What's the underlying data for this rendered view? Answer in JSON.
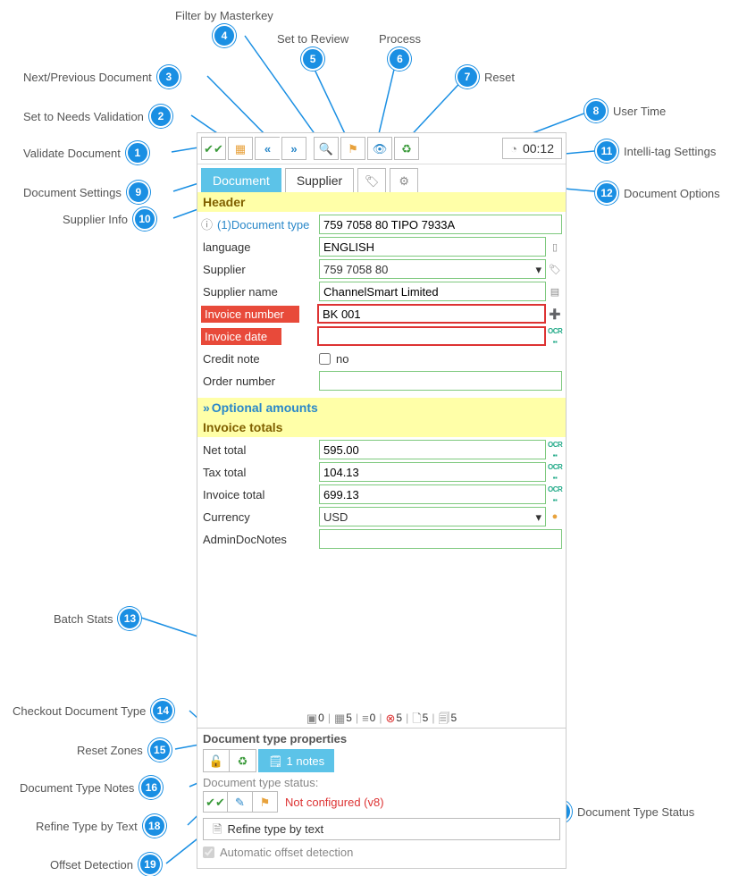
{
  "callouts": {
    "c1": "Validate Document",
    "c2": "Set to Needs Validation",
    "c3": "Next/Previous Document",
    "c4": "Filter by Masterkey",
    "c5": "Set to Review",
    "c6": "Process",
    "c7": "Reset",
    "c8": "User Time",
    "c9": "Document Settings",
    "c10": "Supplier Info",
    "c11": "Intelli-tag Settings",
    "c12": "Document Options",
    "c13": "Batch Stats",
    "c14": "Checkout Document Type",
    "c15": "Reset Zones",
    "c16": "Document Type Notes",
    "c17": "Document Type Status",
    "c18": "Refine Type by Text",
    "c19": "Offset Detection"
  },
  "timer": "00:12",
  "tabs": {
    "document": "Document",
    "supplier": "Supplier"
  },
  "header_section": "Header",
  "optional_section": "Optional amounts",
  "totals_section": "Invoice totals",
  "fields": {
    "doc_type_label": "(1)Document type",
    "doc_type_value": "759 7058 80 TIPO 7933A",
    "language_label": "language",
    "language_value": "ENGLISH",
    "supplier_label": "Supplier",
    "supplier_value": "759 7058 80",
    "supplier_name_label": "Supplier name",
    "supplier_name_value": "ChannelSmart Limited",
    "invoice_number_label": "Invoice number",
    "invoice_number_value": "BK 001",
    "invoice_date_label": "Invoice date",
    "invoice_date_value": "",
    "credit_note_label": "Credit note",
    "credit_note_text": "no",
    "order_number_label": "Order number",
    "order_number_value": "",
    "net_total_label": "Net total",
    "net_total_value": "595.00",
    "tax_total_label": "Tax total",
    "tax_total_value": "104.13",
    "invoice_total_label": "Invoice total",
    "invoice_total_value": "699.13",
    "currency_label": "Currency",
    "currency_value": "USD",
    "admin_notes_label": "AdminDocNotes",
    "admin_notes_value": ""
  },
  "batch": {
    "s1": "0",
    "s2": "5",
    "s3": "0",
    "s4": "5",
    "s5": "5",
    "s6": "5"
  },
  "dt_props": {
    "title": "Document type properties",
    "notes_btn": "1 notes",
    "status_label": "Document type status:",
    "status_value": "Not configured (v8)",
    "refine": "Refine type by text",
    "auto_offset": "Automatic offset detection"
  }
}
